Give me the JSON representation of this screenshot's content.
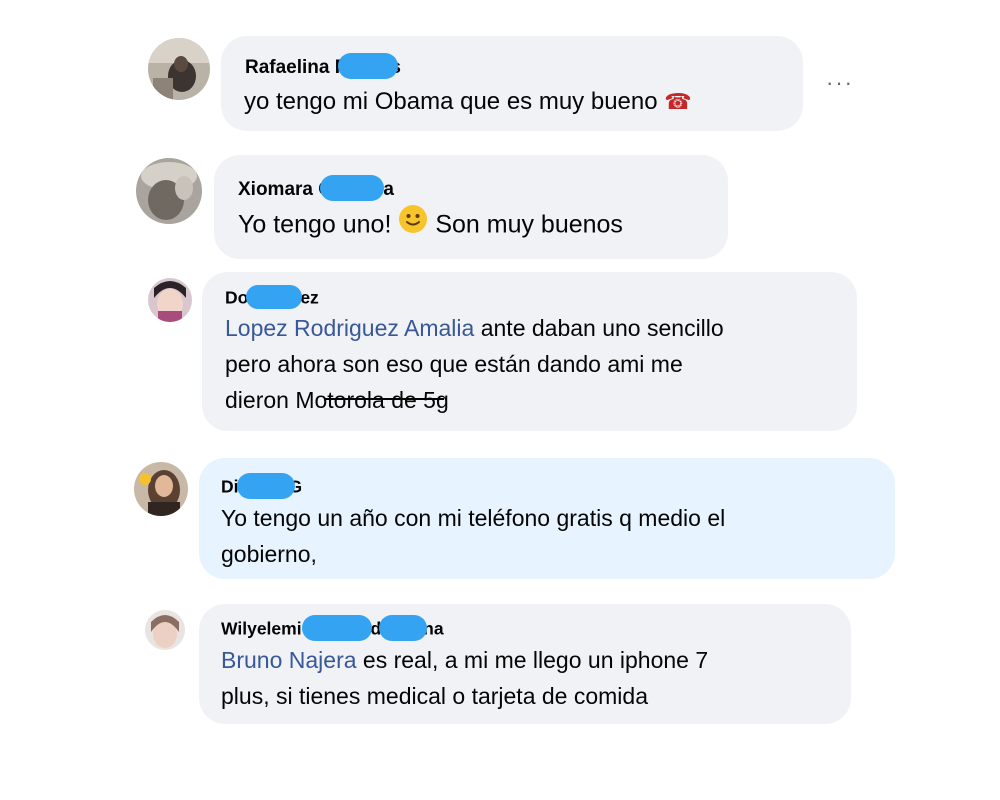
{
  "comments": [
    {
      "name_start": "Rafaelina F",
      "name_end": "s",
      "text": "yo tengo mi Obama que es muy bueno",
      "emoji": "☎"
    },
    {
      "name_start": "Xiomara C",
      "name_end": "ra",
      "text_before": "Yo tengo uno!",
      "text_after": "Son muy buenos"
    },
    {
      "name_start": "Do",
      "name_end": "ez",
      "mention": "Lopez Rodriguez Amalia",
      "line1": "ante daban uno sencillo",
      "line2": "pero ahora son eso que están dando ami me",
      "line3": "dieron Motorola de 5g"
    },
    {
      "name_start": "Di",
      "name_end": "G",
      "line1": "Yo tengo un año con mi teléfono gratis q medio el",
      "line2": "gobierno,"
    },
    {
      "name_start": "Wilyelemi ",
      "name_mid": "d",
      "name_end": "na",
      "mention": "Bruno Najera",
      "line1": "es real, a mi me llego un iphone 7",
      "line2": "plus, si tienes medical o tarjeta de comida"
    }
  ],
  "more_button": "···"
}
